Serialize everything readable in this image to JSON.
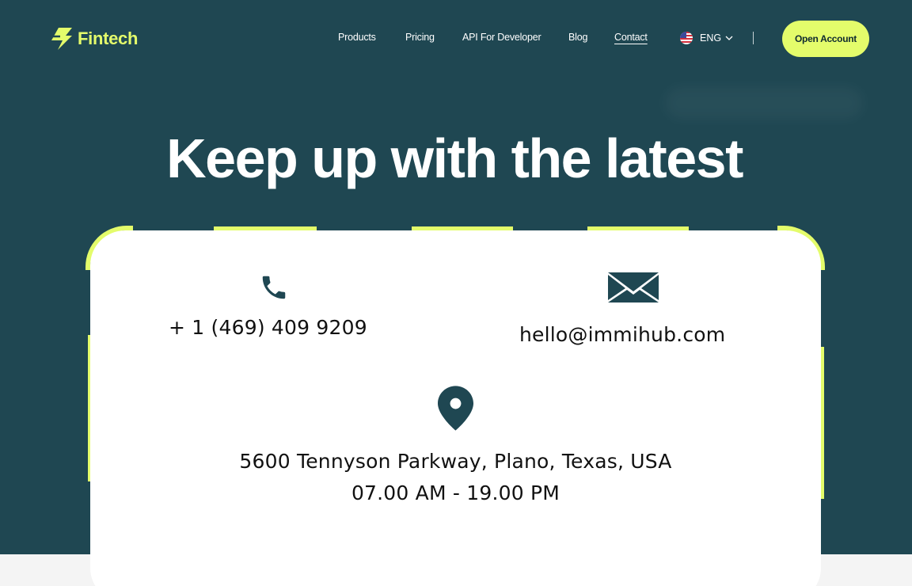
{
  "brand": {
    "name": "Fintech",
    "accent": "#e4fc6b",
    "background": "#1f4752"
  },
  "nav": {
    "items": [
      {
        "label": "Products"
      },
      {
        "label": "Pricing"
      },
      {
        "label": "API For Developer"
      },
      {
        "label": "Blog"
      },
      {
        "label": "Contact",
        "active": true
      }
    ],
    "language": {
      "label": "ENG",
      "flag": "us-flag-icon"
    },
    "cta_label": "Open Account"
  },
  "hero": {
    "title": "Keep up with the latest"
  },
  "contact": {
    "phone": {
      "icon": "phone-icon",
      "value": "+ 1 (469) 409 9209"
    },
    "email": {
      "icon": "envelope-icon",
      "value": "hello@immihub.com"
    },
    "location": {
      "icon": "map-pin-icon",
      "address": "5600 Tennyson Parkway, Plano, Texas, USA",
      "hours": "07.00 AM - 19.00 PM"
    }
  }
}
